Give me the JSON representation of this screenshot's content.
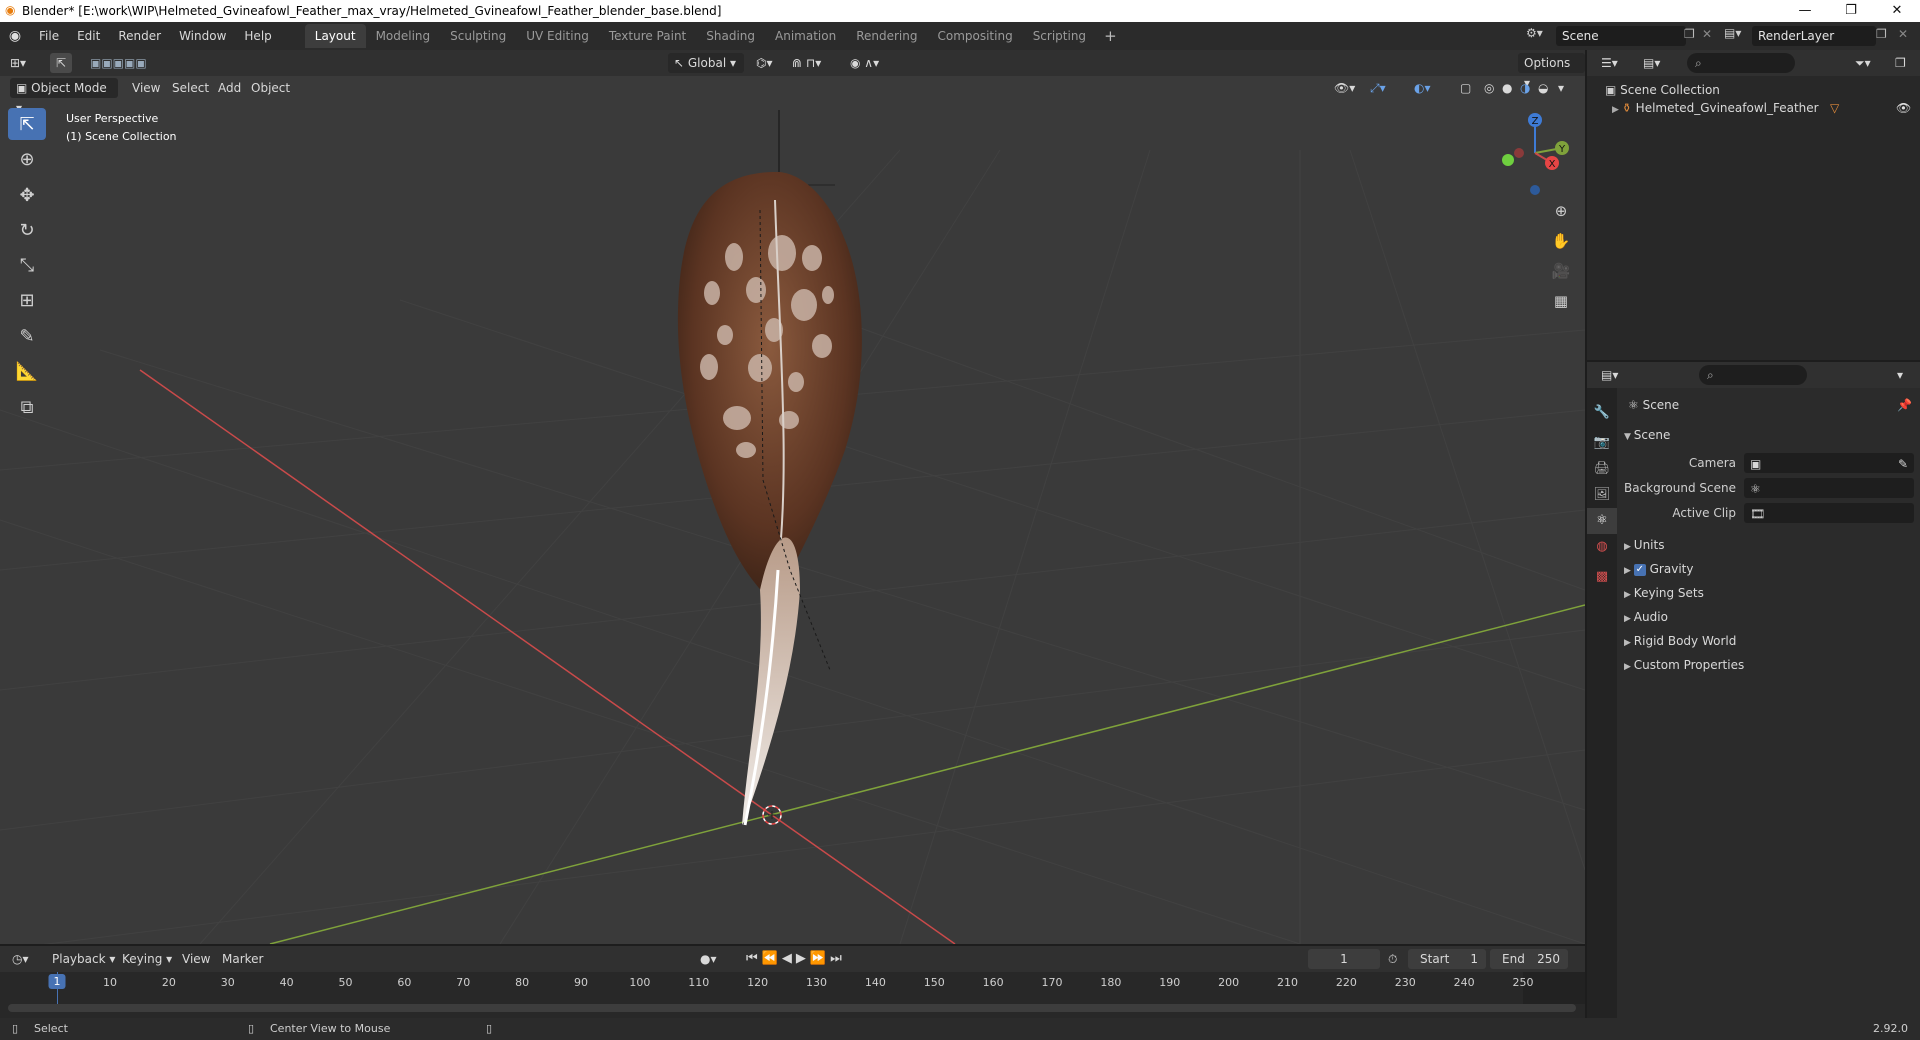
{
  "titlebar": {
    "title": "Blender* [E:\\work\\WIP\\Helmeted_Gvineafowl_Feather_max_vray/Helmeted_Gvineafowl_Feather_blender_base.blend]",
    "minimize": "—",
    "maximize": "❐",
    "close": "✕"
  },
  "menu": [
    "File",
    "Edit",
    "Render",
    "Window",
    "Help"
  ],
  "workspaces": [
    "Layout",
    "Modeling",
    "Sculpting",
    "UV Editing",
    "Texture Paint",
    "Shading",
    "Animation",
    "Rendering",
    "Compositing",
    "Scripting"
  ],
  "active_workspace": "Layout",
  "scene_name": "Scene",
  "view_layer": "RenderLayer",
  "viewport": {
    "mode": "Object Mode",
    "menus": [
      "View",
      "Select",
      "Add",
      "Object"
    ],
    "orientation": "Global",
    "options_label": "Options",
    "perspective": "User Perspective",
    "collection_info": "(1) Scene Collection",
    "gizmo_axes": {
      "x": "X",
      "y": "Y",
      "z": "Z"
    }
  },
  "outliner": {
    "root": "Scene Collection",
    "items": [
      {
        "name": "Helmeted_Gvineafowl_Feather"
      }
    ]
  },
  "properties": {
    "context": "Scene",
    "panel_title": "Scene",
    "fields": [
      {
        "label": "Camera"
      },
      {
        "label": "Background Scene"
      },
      {
        "label": "Active Clip"
      }
    ],
    "sections": [
      "Units",
      "Gravity",
      "Keying Sets",
      "Audio",
      "Rigid Body World",
      "Custom Properties"
    ],
    "gravity_checked": true
  },
  "timeline": {
    "menus": [
      "Playback",
      "Keying",
      "View",
      "Marker"
    ],
    "current_frame": "1",
    "start_label": "Start",
    "start": "1",
    "end_label": "End",
    "end": "250",
    "ticks": [
      "1",
      "10",
      "20",
      "30",
      "40",
      "50",
      "60",
      "70",
      "80",
      "90",
      "100",
      "110",
      "120",
      "130",
      "140",
      "150",
      "160",
      "170",
      "180",
      "190",
      "200",
      "210",
      "220",
      "230",
      "240",
      "250"
    ]
  },
  "statusbar": {
    "select": "Select",
    "center_view": "Center View to Mouse",
    "version": "2.92.0"
  },
  "colors": {
    "accent": "#4772b3",
    "x_axis": "#c94a4a",
    "y_axis": "#7fa23b",
    "z_axis": "#3e7bd6"
  }
}
